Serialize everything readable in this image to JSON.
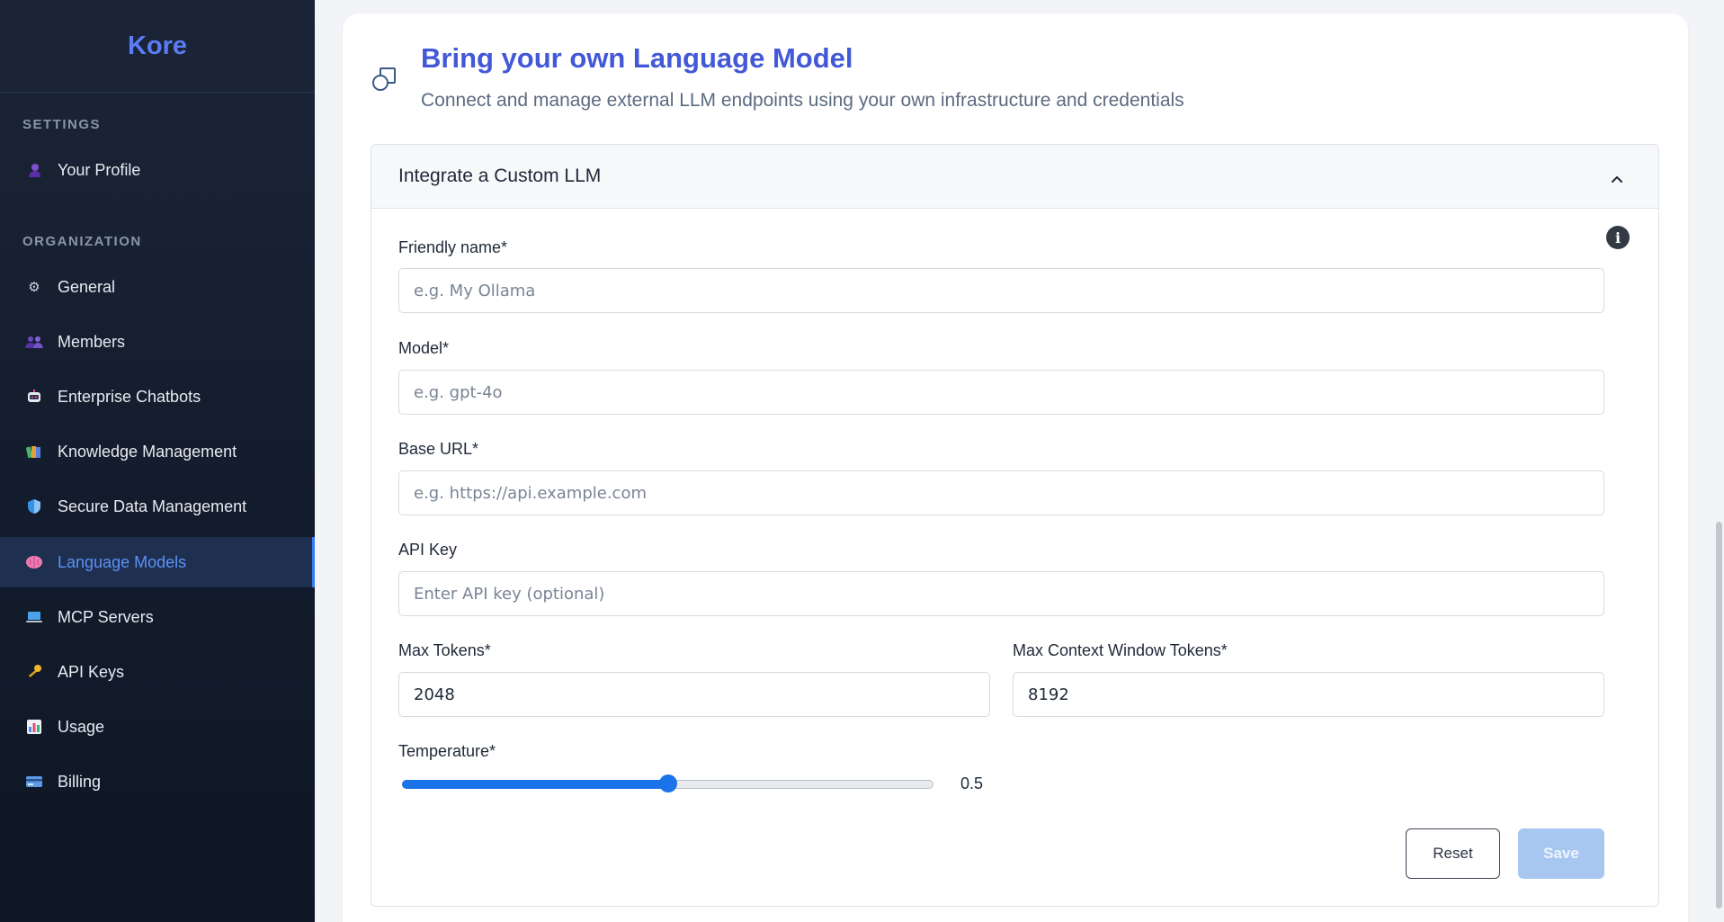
{
  "brand": "Kore",
  "sidebar": {
    "settings_label": "SETTINGS",
    "org_label": "ORGANIZATION",
    "items": [
      {
        "label": "Your Profile",
        "icon": "user-icon"
      },
      {
        "label": "General",
        "icon": "gear-icon"
      },
      {
        "label": "Members",
        "icon": "members-icon"
      },
      {
        "label": "Enterprise Chatbots",
        "icon": "chatbot-icon"
      },
      {
        "label": "Knowledge Management",
        "icon": "books-icon"
      },
      {
        "label": "Secure Data Management",
        "icon": "shield-icon"
      },
      {
        "label": "Language Models",
        "icon": "brain-icon"
      },
      {
        "label": "MCP Servers",
        "icon": "laptop-icon"
      },
      {
        "label": "API Keys",
        "icon": "key-icon"
      },
      {
        "label": "Usage",
        "icon": "chart-icon"
      },
      {
        "label": "Billing",
        "icon": "credit-card-icon"
      }
    ]
  },
  "header": {
    "title": "Bring your own Language Model",
    "subtitle": "Connect and manage external LLM endpoints using your own infrastructure and credentials"
  },
  "panel": {
    "title": "Integrate a Custom LLM"
  },
  "form": {
    "friendly_name": {
      "label": "Friendly name*",
      "placeholder": "e.g. My Ollama",
      "value": ""
    },
    "model": {
      "label": "Model*",
      "placeholder": "e.g. gpt-4o",
      "value": ""
    },
    "base_url": {
      "label": "Base URL*",
      "placeholder": "e.g. https://api.example.com",
      "value": ""
    },
    "api_key": {
      "label": "API Key",
      "placeholder": "Enter API key (optional)",
      "value": ""
    },
    "max_tokens": {
      "label": "Max Tokens*",
      "value": "2048"
    },
    "max_context": {
      "label": "Max Context Window Tokens*",
      "value": "8192"
    },
    "temperature": {
      "label": "Temperature*",
      "value": "0.5",
      "fraction": 0.5
    },
    "reset_label": "Reset",
    "save_label": "Save"
  },
  "colors": {
    "accent": "#4358d6",
    "active_nav": "#5b92f7",
    "slider": "#1a73e8",
    "save_disabled": "#a8c7f0"
  }
}
